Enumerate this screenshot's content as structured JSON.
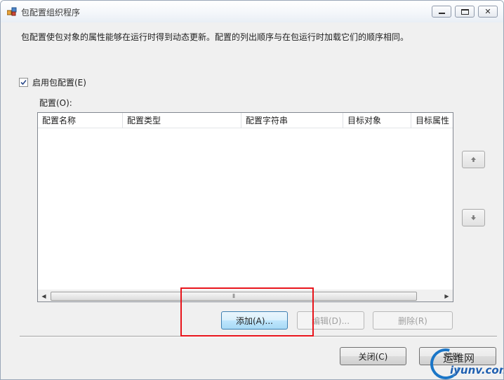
{
  "window": {
    "title": "包配置组织程序",
    "description": "包配置使包对象的属性能够在运行时得到动态更新。配置的列出顺序与在包运行时加载它们的顺序相同。"
  },
  "enable": {
    "label": "启用包配置(E)",
    "checked": true
  },
  "configurations": {
    "label": "配置(O):",
    "columns": [
      "配置名称",
      "配置类型",
      "配置字符串",
      "目标对象",
      "目标属性"
    ],
    "rows": []
  },
  "buttons": {
    "add": "添加(A)...",
    "edit": "编辑(D)...",
    "delete": "删除(R)",
    "close": "关闭(C)",
    "help": "帮助"
  },
  "colors": {
    "highlight": "#e8141b",
    "accent": "#3c7fb1"
  },
  "watermark": {
    "line1": "运维网",
    "line2": "iyunv.com"
  }
}
